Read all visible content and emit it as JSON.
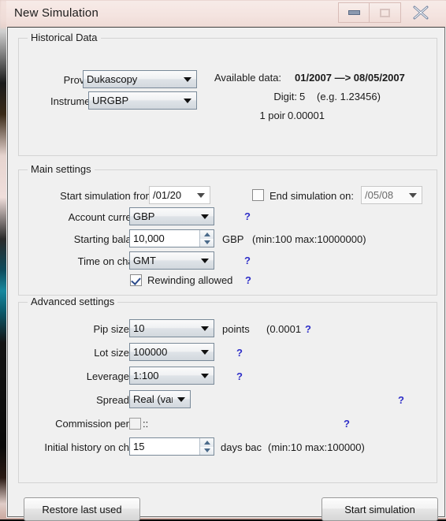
{
  "window": {
    "title": "New Simulation",
    "controls": {
      "minimize": "minimize-button",
      "maximize": "maximize-button",
      "close": "close-button"
    }
  },
  "historical_data": {
    "legend": "Historical Data",
    "provider_label": "Provider",
    "provider_value": "Dukascopy",
    "instrument_label": "Instrument:",
    "instrument_value": "URGBP",
    "available_label": "Available data:",
    "available_value": "01/2007 —> 08/05/2007",
    "digit_label": "Digit:",
    "digit_value": "5",
    "digit_example": "(e.g. 1.23456)",
    "pip_label": "1 poir",
    "pip_value": "0.00001"
  },
  "main_settings": {
    "legend": "Main settings",
    "start_label": "Start simulation from:",
    "start_value": "/01/20",
    "end_label": "End simulation on:",
    "end_value": "/05/08",
    "end_enabled": false,
    "currency_label": "Account curren",
    "currency_value": "GBP",
    "balance_label": "Starting balan",
    "balance_value": "10,000",
    "balance_unit": "GBP",
    "balance_range": "(min:100  max:10000000)",
    "time_label": "Time on char",
    "time_value": "GMT",
    "rewinding_label": "Rewinding allowed",
    "rewinding_checked": true,
    "help": "?"
  },
  "advanced_settings": {
    "legend": "Advanced settings",
    "pip_label": "Pip size",
    "pip_value": "10",
    "pip_unit": "points",
    "pip_note": "(0.0001",
    "lot_label": "Lot size",
    "lot_value": "100000",
    "leverage_label": "Leverage",
    "leverage_value": "1:100",
    "spread_label": "Spread",
    "spread_value": "Real (variabl",
    "commission_label": "Commission per",
    "commission_suffix": "::",
    "commission_checked": false,
    "history_label": "Initial history on ch",
    "history_value": "15",
    "history_unit": "days bac",
    "history_range": "(min:10  max:100000)",
    "help": "?"
  },
  "footer": {
    "restore_label": "Restore last used",
    "start_label": "Start simulation"
  },
  "colors": {
    "dialog_bg": "#f0f0f0",
    "titlebar": "#f4e4e0",
    "help_link": "#2f2fc8",
    "group_border": "#d4d4d4"
  }
}
